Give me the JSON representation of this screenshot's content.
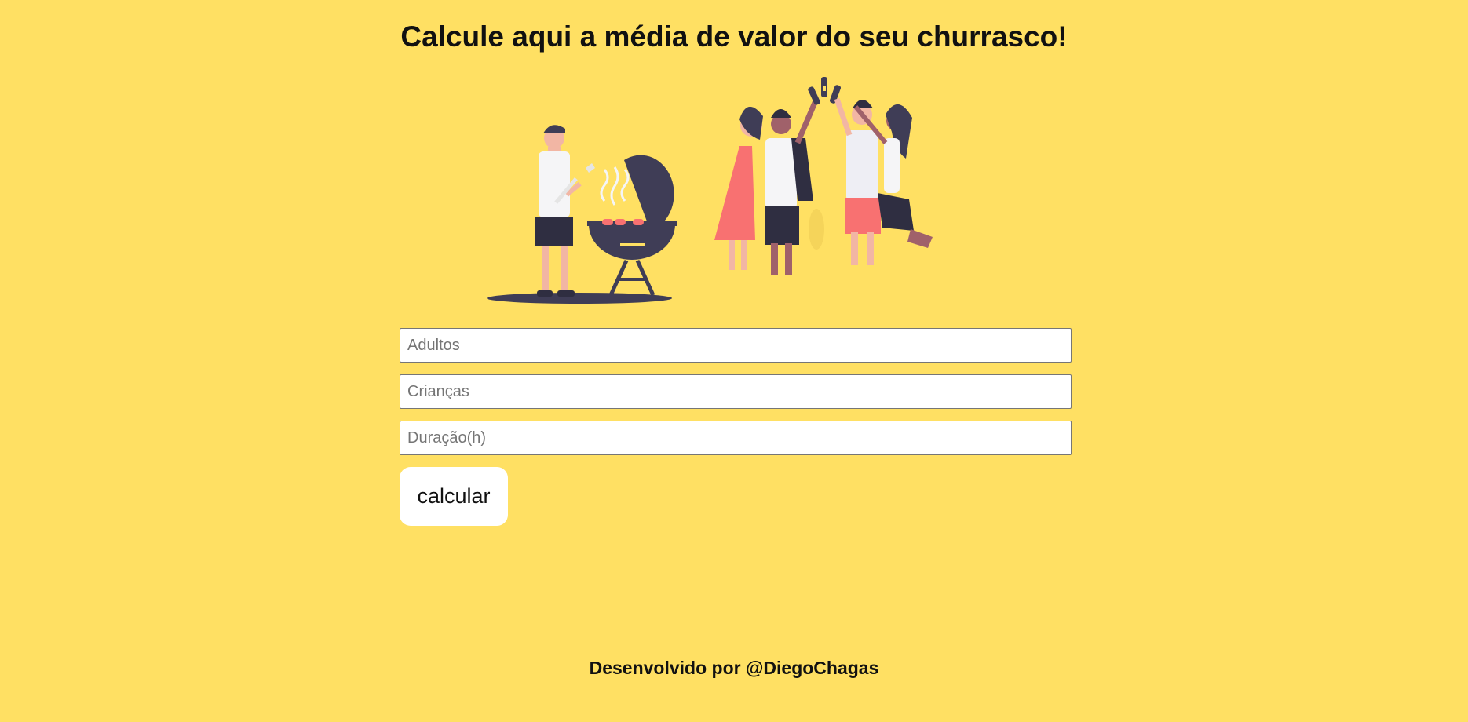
{
  "header": {
    "title": "Calcule aqui a média de valor do seu churrasco!"
  },
  "illustration": {
    "name": "barbecue-party-illustration"
  },
  "form": {
    "adults_placeholder": "Adultos",
    "children_placeholder": "Crianças",
    "duration_placeholder": "Duração(h)",
    "submit_label": "calcular"
  },
  "footer": {
    "credit": "Desenvolvido por @DiegoChagas"
  },
  "colors": {
    "background": "#ffe063",
    "grill": "#3f3d56",
    "accent": "#f87171"
  }
}
